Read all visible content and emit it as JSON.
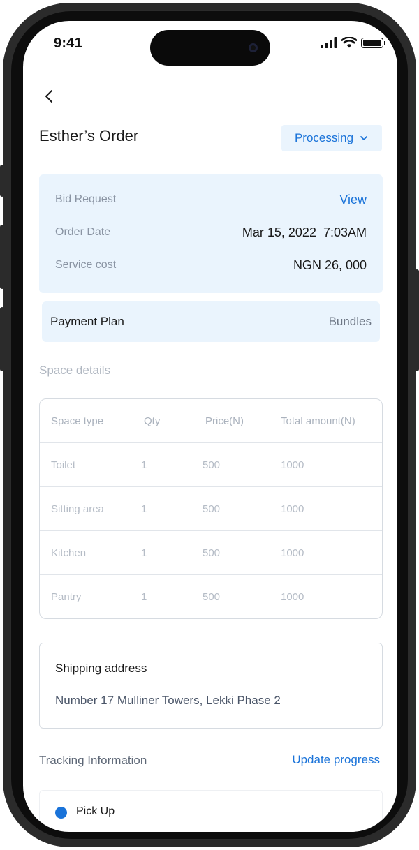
{
  "status_bar": {
    "time": "9:41"
  },
  "header": {
    "title": "Esther’s Order",
    "status_label": "Processing"
  },
  "summary": {
    "bid_request_label": "Bid Request",
    "bid_request_action": "View",
    "order_date_label": "Order Date",
    "order_date_value": "Mar 15, 2022  7:03AM",
    "service_cost_label": "Service cost",
    "service_cost_value": "NGN 26, 000"
  },
  "payment_plan": {
    "label": "Payment Plan",
    "value": "Bundles"
  },
  "space_details": {
    "heading": "Space details",
    "columns": [
      "Space type",
      "Qty",
      "Price(N)",
      "Total amount(N)"
    ],
    "rows": [
      [
        "Toilet",
        "1",
        "500",
        "1000"
      ],
      [
        "Sitting area",
        "1",
        "500",
        "1000"
      ],
      [
        "Kitchen",
        "1",
        "500",
        "1000"
      ],
      [
        "Pantry",
        "1",
        "500",
        "1000"
      ]
    ]
  },
  "shipping": {
    "title": "Shipping address",
    "address": "Number 17 Mulliner Towers, Lekki Phase 2"
  },
  "tracking": {
    "heading": "Tracking Information",
    "action": "Update progress",
    "first_step": "Pick Up"
  },
  "colors": {
    "accent": "#1a73d9",
    "panel": "#eaf4fd"
  }
}
